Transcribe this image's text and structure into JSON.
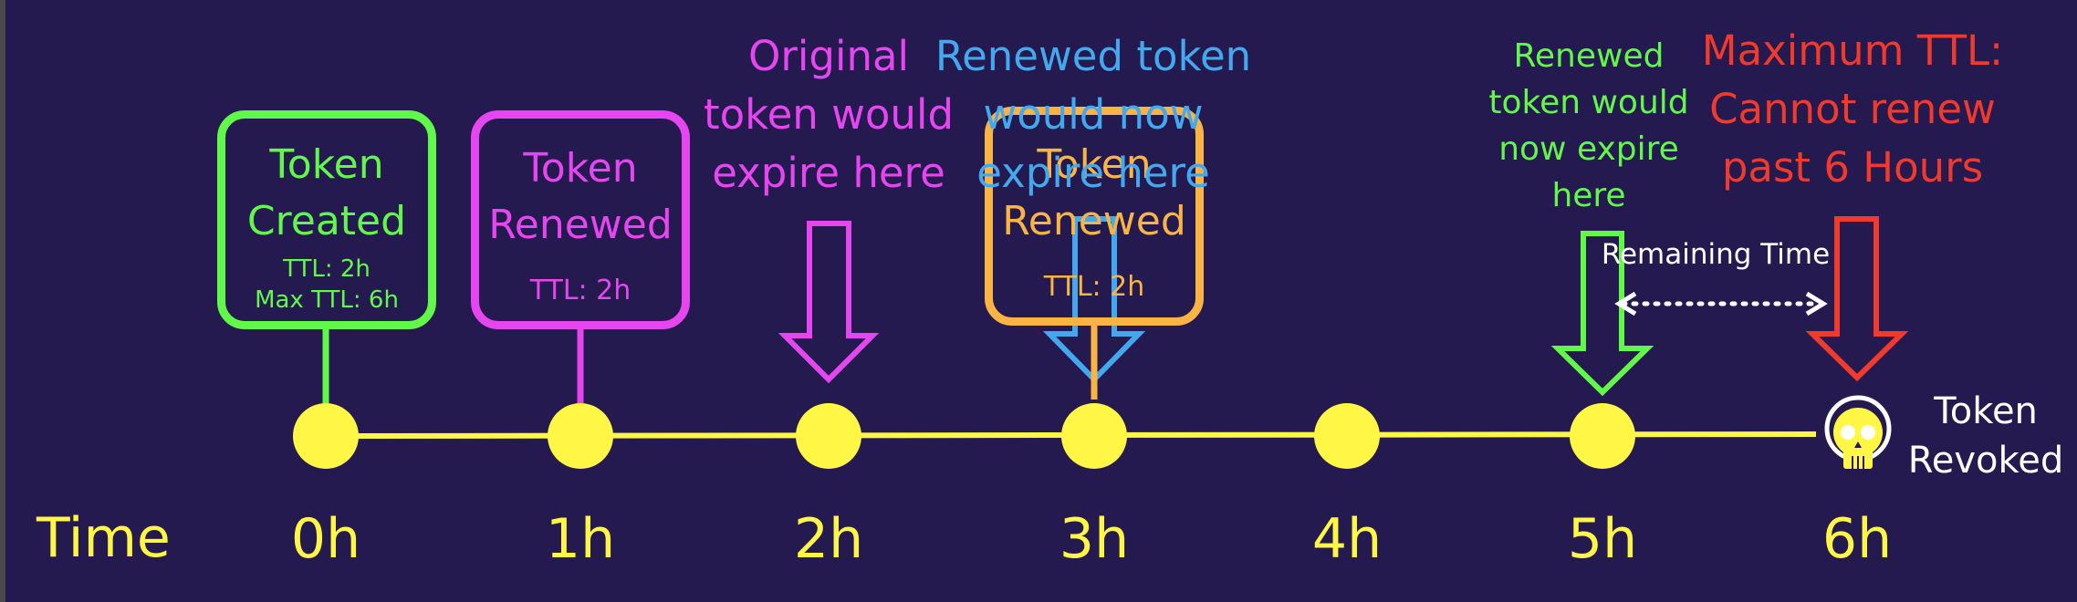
{
  "colors": {
    "background": "#241a4f",
    "timeline": "#fff645",
    "created": "#62f84a",
    "renewed_1": "#e646ef",
    "renewed_2": "#f9b443",
    "renewed_expiry": "#43a8ee",
    "max_ttl": "#ef3a2d",
    "white": "#ffffff"
  },
  "time_axis": {
    "label": "Time",
    "ticks": [
      "0h",
      "1h",
      "2h",
      "3h",
      "4h",
      "5h",
      "6h"
    ]
  },
  "events": {
    "created": {
      "title_1": "Token",
      "title_2": "Created",
      "ttl": "TTL: 2h",
      "max_ttl": "Max TTL: 6h"
    },
    "renewed_1": {
      "title_1": "Token",
      "title_2": "Renewed",
      "ttl": "TTL: 2h"
    },
    "renewed_2": {
      "title_1": "Token",
      "title_2": "Renewed",
      "ttl": "TTL: 2h"
    }
  },
  "annotations": {
    "original_expiry": {
      "line1": "Original",
      "line2": "token would",
      "line3": "expire here"
    },
    "renewed_expiry_3h": {
      "line1": "Renewed token",
      "line2": "would now",
      "line3": "expire here"
    },
    "renewed_expiry_5h": {
      "line1": "Renewed",
      "line2": "token would",
      "line3": "now expire",
      "line4": "here"
    },
    "max_ttl": {
      "line1": "Maximum TTL:",
      "line2": "Cannot renew",
      "line3": "past 6 Hours"
    },
    "remaining_time": "Remaining Time",
    "revoked": {
      "line1": "Token",
      "line2": "Revoked"
    }
  },
  "icons": {
    "revoked": "skull-icon"
  }
}
